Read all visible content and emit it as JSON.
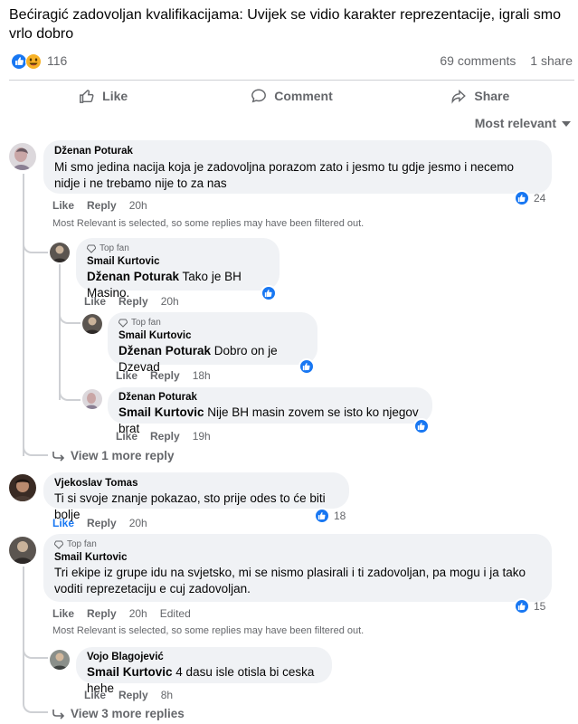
{
  "post": {
    "title": "Bećiragić zadovoljan kvalifikacijama: Uvijek se vidio karakter reprezentacije, igrali smo vrlo dobro",
    "reaction_count": "116",
    "comments": "69 comments",
    "shares": "1 share"
  },
  "actions": {
    "like": "Like",
    "comment": "Comment",
    "share": "Share"
  },
  "sort": {
    "label": "Most relevant"
  },
  "labels": {
    "like": "Like",
    "reply": "Reply",
    "edited": "Edited",
    "top_fan": "Top fan",
    "filter_note": "Most Relevant is selected, so some replies may have been filtered out."
  },
  "comments": [
    {
      "author": "Dženan Poturak",
      "text": "Mi smo jedina nacija koja je zadovoljna porazom zato i jesmo tu gdje jesmo i necemo nidje i ne trebamo nije to za nas",
      "time": "20h",
      "reactions": "24",
      "replies": [
        {
          "author": "Smail Kurtovic",
          "mention": "Dženan Poturak",
          "text": "Tako je BH Masino.",
          "time": "20h"
        },
        {
          "author": "Smail Kurtovic",
          "mention": "Dženan Poturak",
          "text": "Dobro on je Dzevad",
          "time": "18h"
        },
        {
          "author": "Dženan Poturak",
          "mention": "Smail Kurtovic",
          "text": "Nije BH masin zovem se isto ko njegov brat",
          "time": "19h"
        }
      ],
      "view_more": "View 1 more reply"
    },
    {
      "author": "Vjekoslav Tomas",
      "text": "Ti si svoje znanje pokazao, sto prije odes to će biti bolje",
      "time": "20h",
      "reactions": "18"
    },
    {
      "author": "Smail Kurtovic",
      "text": "Tri ekipe iz grupe idu na svjetsko, mi se nismo plasirali i ti zadovoljan, pa mogu i ja tako voditi reprezetaciju e cuj zadovoljan.",
      "time": "20h",
      "reactions": "15",
      "replies": [
        {
          "author": "Vojo Blagojević",
          "mention": "Smail Kurtovic",
          "text": "4 dasu isle otisla bi ceska hehe",
          "time": "8h"
        }
      ],
      "view_more": "View 3 more replies"
    }
  ],
  "colors": {
    "accent": "#1877f2",
    "muted": "#65676b",
    "bubble": "#f0f2f5"
  }
}
